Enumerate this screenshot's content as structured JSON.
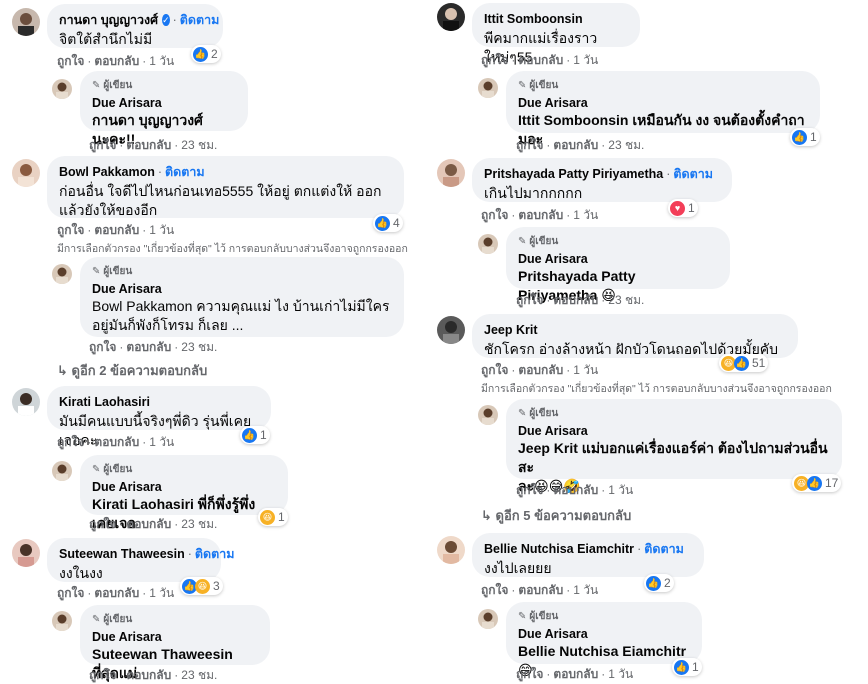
{
  "labels": {
    "follow": "ติดตาม",
    "like": "ถูกใจ",
    "reply": "ตอบกลับ",
    "author_tag": "ผู้เขียน",
    "filter_note": "มีการเลือกตัวกรอง \"เกี่ยวข้องที่สุด\" ไว้ การตอบกลับบางส่วนจึงอาจถูกกรองออก"
  },
  "colors": {
    "accent": "#1877f2",
    "bubble": "#f0f2f5",
    "meta": "#65676b"
  },
  "left": {
    "c1": {
      "author": "กานดา บุญญาวงศ์",
      "text": "จิตใต้สำนึกไม่มี",
      "time": "1 วัน",
      "react_count": "2",
      "reply": {
        "author": "Due Arisara",
        "text": "กานดา บุญญาวงศ์ นะคะ!!",
        "time": "23 ชม."
      }
    },
    "c2": {
      "author": "Bowl Pakkamon",
      "text": "ก่อนอื่น ใจดีไปไหนก่อนเทอ5555 ให้อยู่ ตกแต่งให้ ออกแล้วยังให้ของอีก",
      "time": "1 วัน",
      "react_count": "4",
      "reply": {
        "author": "Due Arisara",
        "text": "Bowl Pakkamon ความคุณแม่ ไง บ้านเก่าไม่มีใครอยู่มันก็พังก็โทรม ก็เลย ...",
        "time": "23 ชม."
      },
      "more": "ดูอีก 2 ข้อความตอบกลับ"
    },
    "c3": {
      "author": "Kirati Laohasiri",
      "text": "มันมีคนแบบนี้จริงๆพี่ดิว รุ่นพี่เคยเจอคะ",
      "time": "1 วัน",
      "react_count": "1",
      "reply": {
        "author": "Due Arisara",
        "text": "Kirati Laohasiri พี่ก็พึ่งรู้พึ่งเคยเจอ",
        "time": "23 ชม.",
        "react_count": "1"
      }
    },
    "c4": {
      "author": "Suteewan Thaweesin",
      "text": "งงในงง",
      "time": "1 วัน",
      "react_count": "3",
      "reply": {
        "author": "Due Arisara",
        "text": "Suteewan Thaweesin ที่สุดแม่",
        "time": "23 ชม."
      }
    }
  },
  "right": {
    "c1": {
      "author": "Ittit Somboonsin",
      "text": "พีคมากแม่เรื่องราวใหม่ๆ55",
      "time": "1 วัน",
      "reply": {
        "author": "Due Arisara",
        "text": "Ittit Somboonsin เหมือนกัน งง จนต้องตั้งคำถามอะ",
        "time": "23 ชม.",
        "react_count": "1"
      }
    },
    "c2": {
      "author": "Pritshayada Patty Piriyametha",
      "text": "เกินไปมากกกกก",
      "time": "1 วัน",
      "react_count": "1",
      "reply": {
        "author": "Due Arisara",
        "text": "Pritshayada Patty Piriyametha",
        "time": "23 ชม."
      }
    },
    "c3": {
      "author": "Jeep Krit",
      "text": "ชักโครก อ่างล้างหน้า ฝักบัวโดนถอดไปด้วยมั้ยคับ",
      "time": "1 วัน",
      "react_count": "51",
      "reply": {
        "author": "Due Arisara",
        "text_line1": "Jeep Krit แม่บอกแค่เรื่องแอร์ค่า ต้องไปถามส่วนอื่นสะ",
        "text_line2": "ละ",
        "time": "1 วัน",
        "react_count": "17"
      },
      "more": "ดูอีก 5 ข้อความตอบกลับ"
    },
    "c4": {
      "author": "Bellie Nutchisa Eiamchitr",
      "text": "งงไปเลยยย",
      "time": "1 วัน",
      "react_count": "2",
      "reply": {
        "author": "Due Arisara",
        "text": "Bellie Nutchisa Eiamchitr",
        "time": "1 วัน",
        "react_count": "1"
      }
    }
  }
}
